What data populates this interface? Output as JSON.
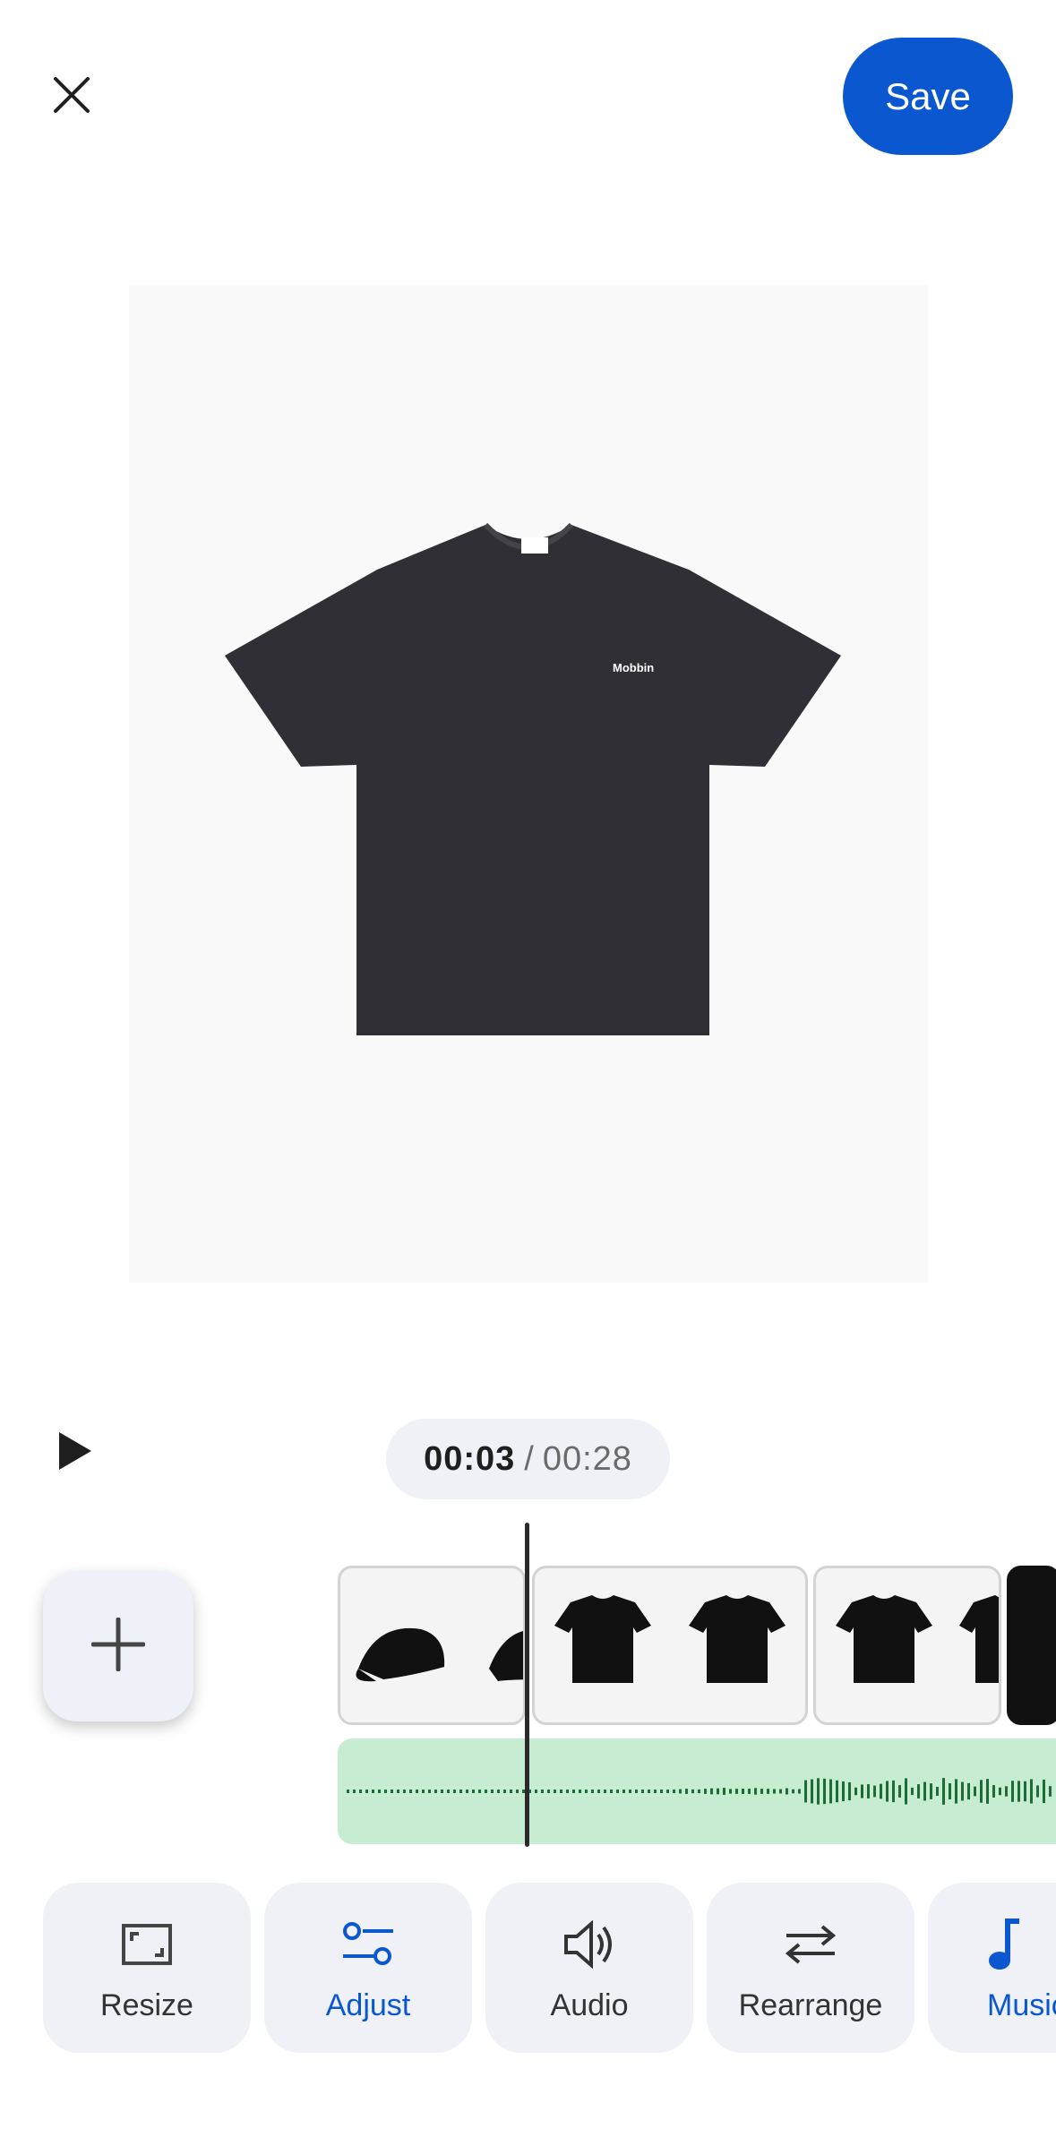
{
  "header": {
    "save_label": "Save",
    "close_icon": "close-icon"
  },
  "preview": {
    "shirt_logo_text": "Mobbin"
  },
  "playback": {
    "current_time": "00:03",
    "separator": "/",
    "total_time": "00:28"
  },
  "tools": [
    {
      "label": "Resize",
      "icon": "resize-icon",
      "active": false
    },
    {
      "label": "Adjust",
      "icon": "adjust-icon",
      "active": true
    },
    {
      "label": "Audio",
      "icon": "volume-icon",
      "active": false
    },
    {
      "label": "Rearrange",
      "icon": "swap-icon",
      "active": false
    },
    {
      "label": "Music",
      "icon": "music-note-icon",
      "active": true
    }
  ],
  "colors": {
    "accent": "#0b57d0",
    "audio_track": "#c6edd1",
    "waveform": "#1e6b38"
  }
}
